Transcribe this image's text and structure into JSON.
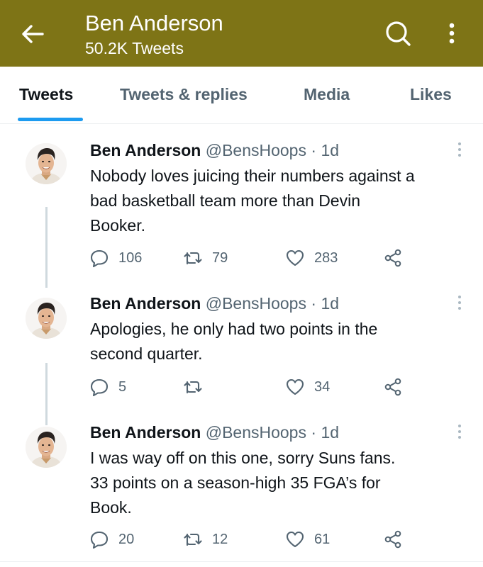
{
  "header": {
    "title": "Ben Anderson",
    "subtitle": "50.2K Tweets",
    "background_color": "#7e7416",
    "icons": [
      "back-arrow-icon",
      "search-icon",
      "more-vertical-icon"
    ]
  },
  "tabs": [
    {
      "label": "Tweets",
      "active": true
    },
    {
      "label": "Tweets & replies",
      "active": false
    },
    {
      "label": "Media",
      "active": false
    },
    {
      "label": "Likes",
      "active": false
    }
  ],
  "accent_color": "#1d9bf0",
  "tweets": [
    {
      "name": "Ben Anderson",
      "handle": "@BensHoops",
      "separator": "·",
      "time": "1d",
      "text_lines": [
        "Nobody loves juicing their numbers against a",
        "bad basketball team more than Devin",
        "Booker."
      ],
      "replies": "106",
      "retweets": "79",
      "likes": "283"
    },
    {
      "name": "Ben Anderson",
      "handle": "@BensHoops",
      "separator": "·",
      "time": "1d",
      "text_lines": [
        "Apologies, he only had two points in the",
        "second quarter."
      ],
      "replies": "5",
      "retweets": "",
      "likes": "34"
    },
    {
      "name": "Ben Anderson",
      "handle": "@BensHoops",
      "separator": "·",
      "time": "1d",
      "text_lines": [
        "I was way off on this one, sorry Suns fans.",
        "33 points on a season-high 35 FGA’s for",
        "Book."
      ],
      "replies": "20",
      "retweets": "12",
      "likes": "61"
    }
  ]
}
